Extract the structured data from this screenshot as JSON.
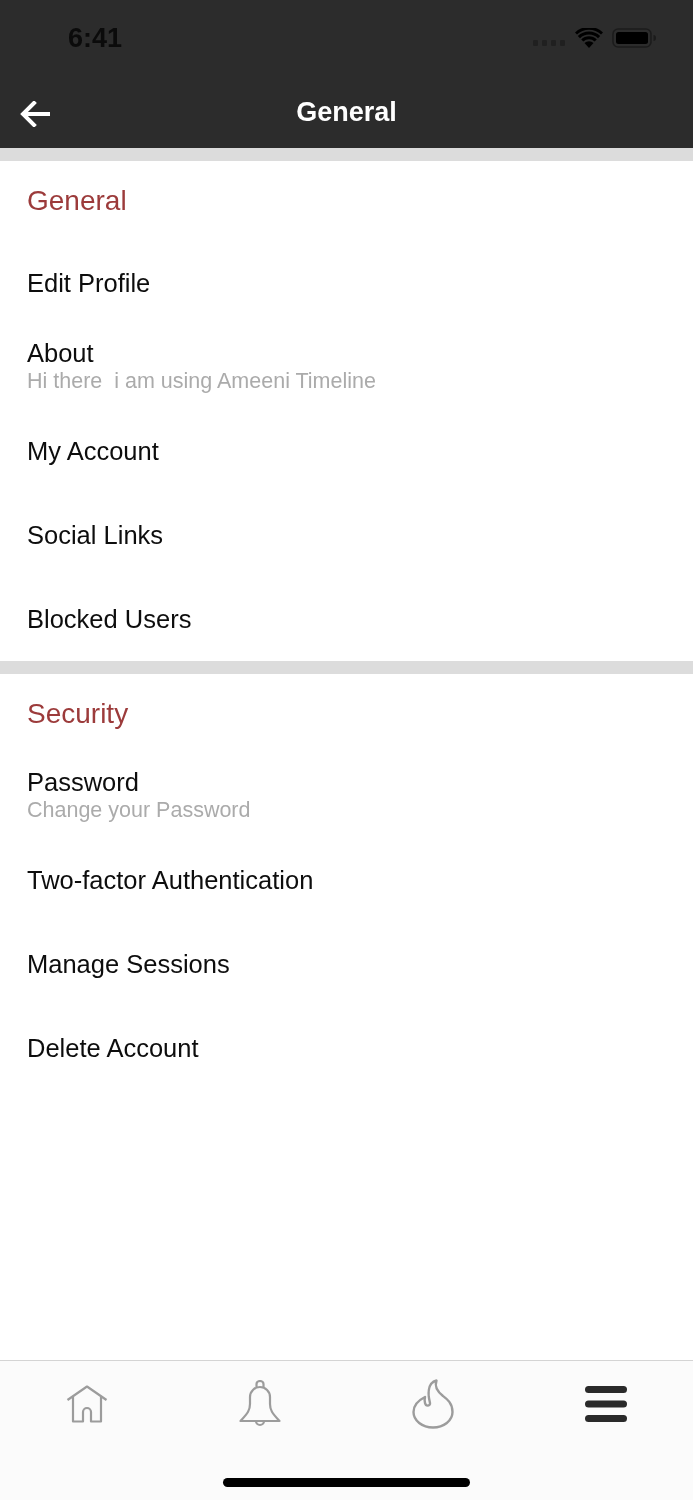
{
  "status_bar": {
    "time": "6:41"
  },
  "nav_bar": {
    "title": "General"
  },
  "sections": [
    {
      "title": "General",
      "items": [
        {
          "label": "Edit Profile"
        },
        {
          "label": "About",
          "subtitle": "Hi there  i am using Ameeni Timeline"
        },
        {
          "label": "My Account"
        },
        {
          "label": "Social Links"
        },
        {
          "label": "Blocked Users"
        }
      ]
    },
    {
      "title": "Security",
      "items": [
        {
          "label": "Password",
          "subtitle": "Change your Password"
        },
        {
          "label": "Two-factor Authentication"
        },
        {
          "label": "Manage Sessions"
        },
        {
          "label": "Delete Account"
        }
      ]
    }
  ],
  "tab_bar": {
    "tabs": [
      {
        "kind": "home",
        "selected": false
      },
      {
        "kind": "bell",
        "selected": false
      },
      {
        "kind": "flame",
        "selected": false
      },
      {
        "kind": "menu",
        "selected": true
      }
    ]
  }
}
